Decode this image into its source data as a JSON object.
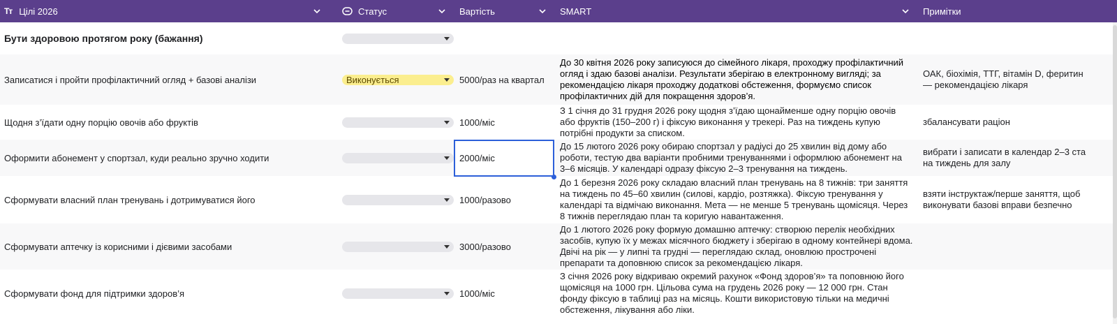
{
  "colors": {
    "header_bg": "#5b3f8c",
    "selection": "#2c5fd9",
    "status_active": "#fbee8f"
  },
  "columns": {
    "goal": {
      "icon": "text-type-icon",
      "label": "Цілі 2026"
    },
    "status": {
      "icon": "status-pill-icon",
      "label": "Статус"
    },
    "cost": {
      "label": "Вартість"
    },
    "smart": {
      "label": "SMART"
    },
    "notes": {
      "label": "Примітки"
    }
  },
  "group": {
    "title": "Бути здоровою протягом року (бажання)"
  },
  "rows": [
    {
      "goal": "Записатися і пройти профілактичний огляд + базові аналізи",
      "status": "Виконується",
      "cost": "5000/раз на квартал",
      "smart": "До 30 квітня 2026 року записуюся до сімейного лікаря, проходжу профілактичний огляд і здаю базові аналізи. Результати зберігаю в електронному вигляді; за рекомендацією лікаря проходжу додаткові обстеження, формуємо список профілактичних дій для покращення здоров’я.",
      "notes": "ОАК, біохімія, ТТГ, вітамін D, феритин — рекомендацією лікаря"
    },
    {
      "goal": "Щодня з’їдати одну порцію овочів або фруктів",
      "status": "",
      "cost": "1000/міс",
      "smart": "З 1 січня до 31 грудня 2026 року щодня з’їдаю щонайменше одну порцію овочів або фруктів (150–200 г) і фіксую виконання у трекері. Раз на тиждень купую потрібні продукти за списком.",
      "notes": "збалансувати раціон"
    },
    {
      "goal": "Оформити абонемент у спортзал, куди реально зручно ходити",
      "status": "",
      "cost": "2000/міс",
      "smart": "До 15 лютого 2026 року обираю спортзал у радіусі до 25 хвилин від дому або роботи, тестую два варіанти пробними тренуваннями і оформлюю абонемент на 3–6 місяців. У календарі одразу фіксую 2–3 тренування на тиждень.",
      "notes": "вибрати і записати в календар 2–3 ста на тиждень для залу"
    },
    {
      "goal": "Сформувати власний план тренувань і дотримуватися його",
      "status": "",
      "cost": "1000/разово",
      "smart": "До 1 березня 2026 року складаю власний план тренувань на 8 тижнів: три заняття на тиждень по 45–60 хвилин (силові, кардіо, розтяжка). Фіксую тренування у календарі та відмічаю виконання. Мета — не менше  5 тренувань щомісяця. Через 8 тижнів переглядаю план та коригую навантаження.",
      "notes": "взяти інструктаж/перше заняття, щоб виконувати базові вправи безпечно"
    },
    {
      "goal": "Сформувати аптечку із корисними і дієвими засобами",
      "status": "",
      "cost": "3000/разово",
      "smart": "До 1 лютого 2026 року формую домашню аптечку: створюю перелік необхідних засобів, купую їх у межах місячного бюджету і зберігаю в одному контейнері вдома. Двічі на рік — у липні та грудні — переглядаю склад, оновлюю прострочені препарати та доповнюю список за рекомендацією лікаря.",
      "notes": ""
    },
    {
      "goal": "Сформувати фонд для підтримки здоров’я",
      "status": "",
      "cost": "1000/міс",
      "smart": "З січня 2026 року відкриваю окремий рахунок «Фонд здоров’я» та поповнюю його щомісяця на 1000 грн. Цільова сума на грудень 2026 року — 12 000 грн. Стан фонду фіксую в таблиці раз на місяць. Кошти використовую тільки на медичні обстеження, лікування або ліки.",
      "notes": ""
    }
  ]
}
